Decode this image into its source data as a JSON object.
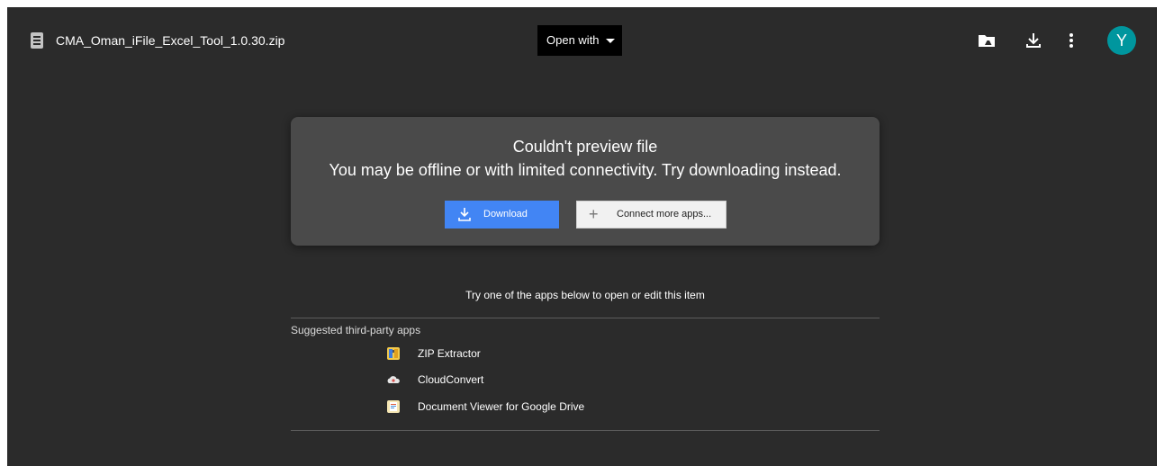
{
  "header": {
    "file_name": "CMA_Oman_iFile_Excel_Tool_1.0.30.zip",
    "file_icon": "archive-file-icon",
    "open_with_label": "Open with",
    "actions": [
      {
        "name": "add-to-drive-button",
        "icon": "add-to-drive-icon"
      },
      {
        "name": "download-button",
        "icon": "download-icon"
      },
      {
        "name": "more-options-button",
        "icon": "more-vert-icon"
      }
    ],
    "avatar_initial": "Y",
    "avatar_color": "#00969e"
  },
  "preview": {
    "title": "Couldn't preview file",
    "message": "You may be offline or with limited connectivity. Try downloading instead.",
    "download_label": "Download",
    "connect_label": "Connect more apps...",
    "connect_icon": "plus-icon",
    "download_icon": "download-arrow-icon"
  },
  "apps": {
    "prompt": "Try one of the apps below to open or edit this item",
    "heading": "Suggested third-party apps",
    "items": [
      {
        "name": "ZIP Extractor",
        "icon": "zip-extractor-icon",
        "color": "#f2c94c"
      },
      {
        "name": "CloudConvert",
        "icon": "cloudconvert-icon",
        "color": "#e6e6e6"
      },
      {
        "name": "Document Viewer for Google Drive",
        "icon": "document-viewer-icon",
        "color": "#f5e6b3"
      }
    ]
  },
  "colors": {
    "background": "#2b2b2b",
    "card": "#4a4a4a",
    "primary_button": "#4285f4"
  }
}
